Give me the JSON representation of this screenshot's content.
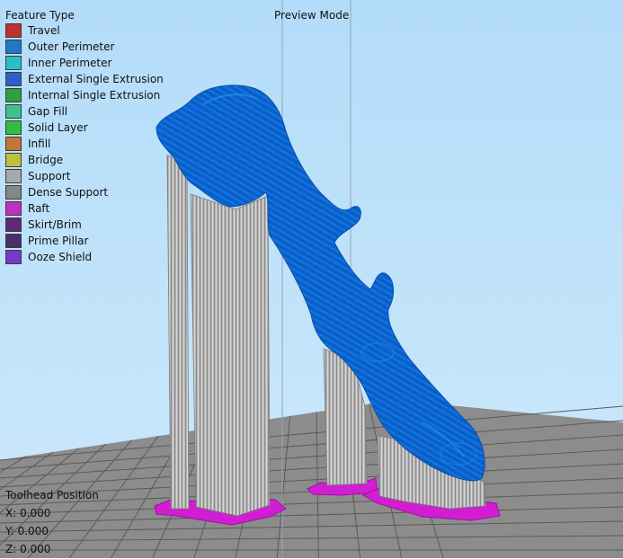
{
  "legend": {
    "title": "Feature Type",
    "items": [
      {
        "label": "Travel",
        "color": "#c03030"
      },
      {
        "label": "Outer Perimeter",
        "color": "#1f78c8"
      },
      {
        "label": "Inner Perimeter",
        "color": "#28c0c8"
      },
      {
        "label": "External Single Extrusion",
        "color": "#2d5fc8"
      },
      {
        "label": "Internal Single Extrusion",
        "color": "#2da040"
      },
      {
        "label": "Gap Fill",
        "color": "#40c090"
      },
      {
        "label": "Solid Layer",
        "color": "#30c040"
      },
      {
        "label": "Infill",
        "color": "#c07838"
      },
      {
        "label": "Bridge",
        "color": "#c0c038"
      },
      {
        "label": "Support",
        "color": "#a8a8a8"
      },
      {
        "label": "Dense Support",
        "color": "#808888"
      },
      {
        "label": "Raft",
        "color": "#c030c0"
      },
      {
        "label": "Skirt/Brim",
        "color": "#602878"
      },
      {
        "label": "Prime Pillar",
        "color": "#483068"
      },
      {
        "label": "Ooze Shield",
        "color": "#7838c8"
      }
    ]
  },
  "view": {
    "mode_label": "Preview Mode"
  },
  "toolhead": {
    "title": "Toolhead Position",
    "x": "X: 0.000",
    "y": "Y: 0.000",
    "z": "Z: 0.000"
  },
  "colors": {
    "sky_top": "#b3dcfa",
    "sky_bottom": "#cde9fb",
    "bed": "#8a8a8a",
    "bed_grid": "#5a5a5a",
    "model": "#0a64d2",
    "support": "#b4b4b4",
    "raft": "#d21ed2"
  }
}
